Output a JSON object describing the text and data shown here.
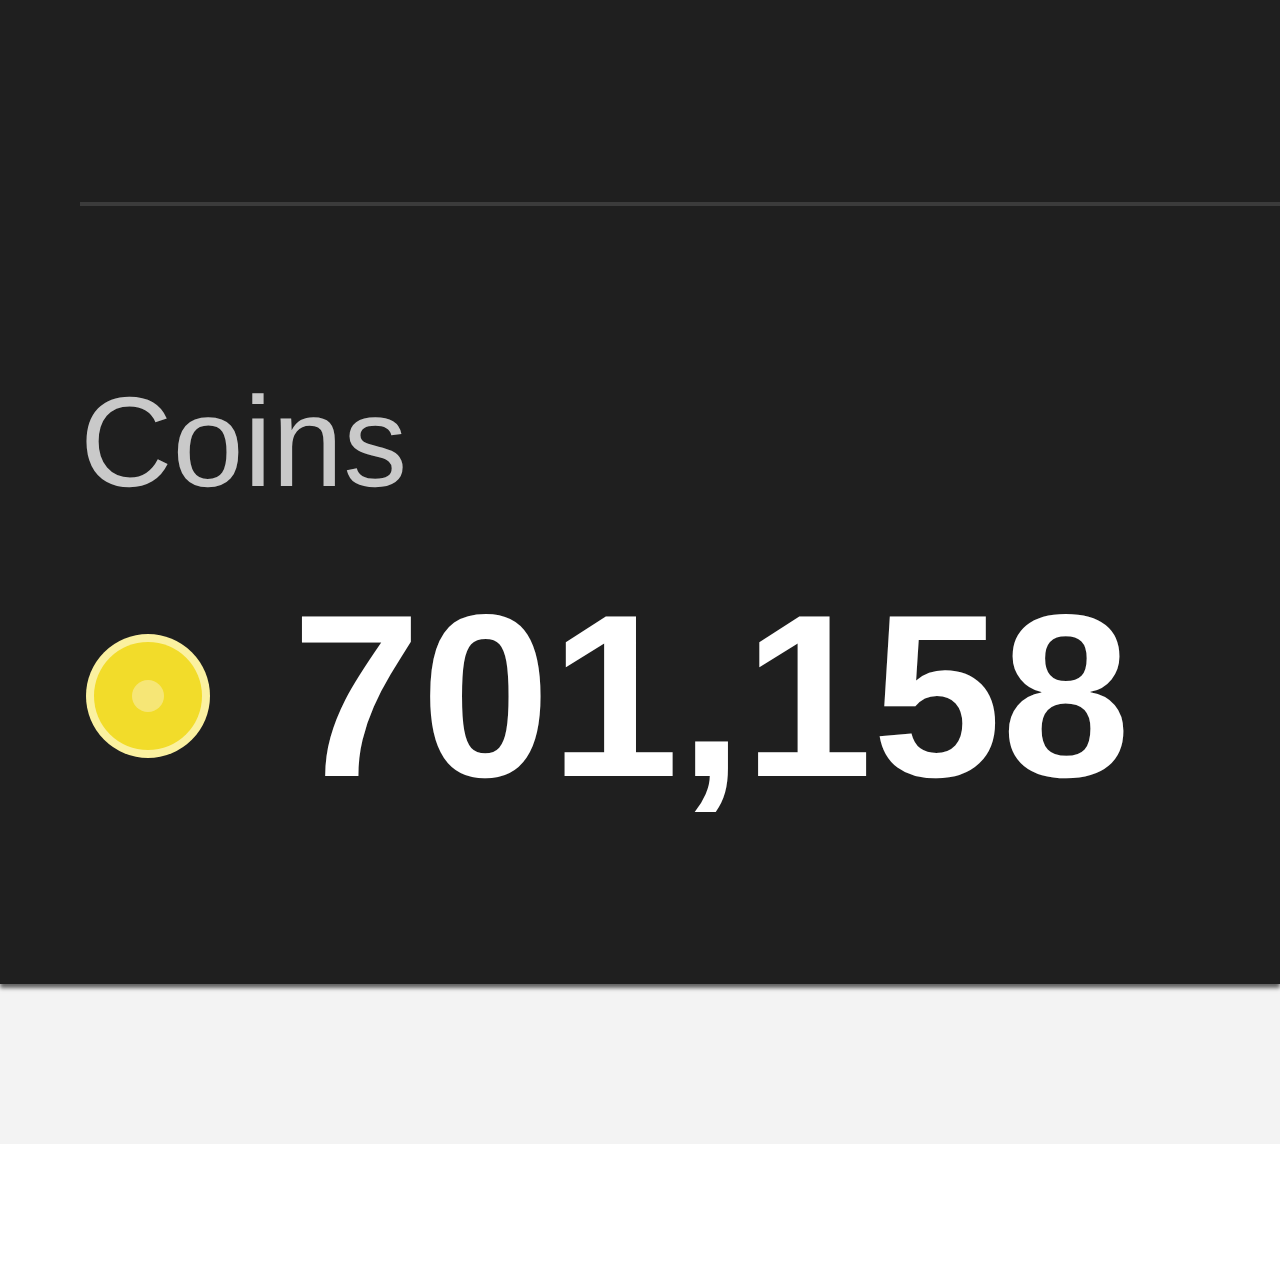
{
  "balance": {
    "label": "Coins",
    "value": "701,158"
  }
}
